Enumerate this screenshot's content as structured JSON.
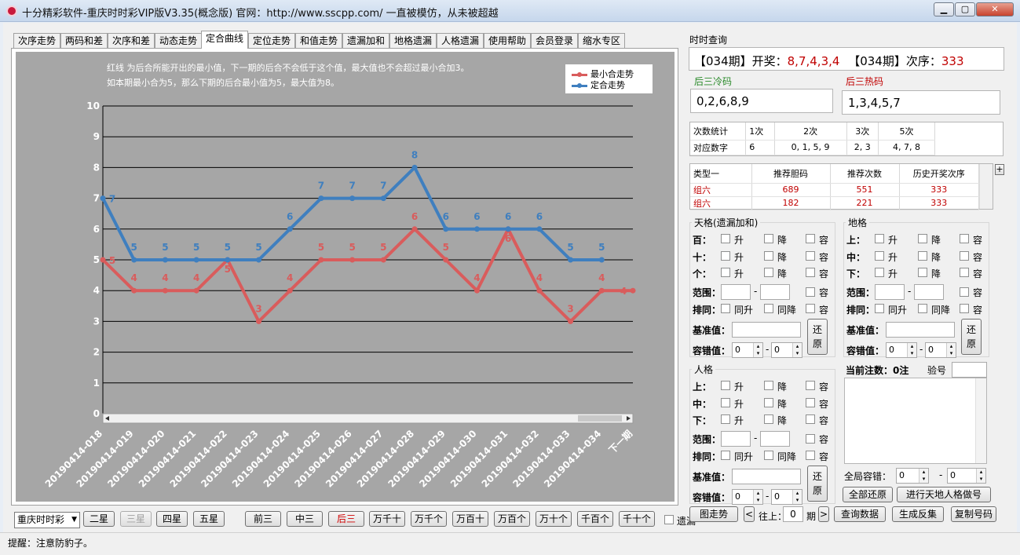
{
  "window": {
    "title": "十分精彩软件-重庆时时彩VIP版V3.35(概念版) 官网：http://www.sscpp.com/ 一直被模仿，从未被超越",
    "min": "▁",
    "max": "▢",
    "close": "✕"
  },
  "tabs": [
    "次序走势",
    "两码和差",
    "次序和差",
    "动态走势",
    "定合曲线",
    "定位走势",
    "和值走势",
    "遗漏加和",
    "地格遗漏",
    "人格遗漏",
    "使用帮助",
    "会员登录",
    "缩水专区"
  ],
  "active_tab": 4,
  "chart_note": [
    "红线 为后合所能开出的最小值，下一期的后合不会低于这个值，最大值也不会超过最小合加3。",
    "如本期最小合为5，那么下期的后合最小值为5，最大值为8。"
  ],
  "chart_data": {
    "type": "line",
    "categories": [
      "20190414-018",
      "20190414-019",
      "20190414-020",
      "20190414-021",
      "20190414-022",
      "20190414-023",
      "20190414-024",
      "20190414-025",
      "20190414-026",
      "20190414-027",
      "20190414-028",
      "20190414-029",
      "20190414-030",
      "20190414-031",
      "20190414-032",
      "20190414-033",
      "20190414-034",
      "下一期"
    ],
    "ylim": [
      0,
      10
    ],
    "yticks": [
      "0",
      "1",
      "2",
      "3",
      "4",
      "5",
      "6",
      "7",
      "8",
      "9",
      "10"
    ],
    "grid": true,
    "legend": "top-right",
    "series": [
      {
        "name": "最小合走势",
        "color": "#d95c5c",
        "values": [
          5,
          4,
          4,
          4,
          5,
          3,
          4,
          5,
          5,
          5,
          6,
          5,
          4,
          6,
          4,
          3,
          4,
          4
        ]
      },
      {
        "name": "定合走势",
        "color": "#3f7fbf",
        "values": [
          7,
          5,
          5,
          5,
          5,
          5,
          6,
          7,
          7,
          7,
          8,
          6,
          6,
          6,
          6,
          5,
          5
        ]
      }
    ]
  },
  "right": {
    "query_title": "时时查询",
    "draw_bracket_l": "【034期】开奖：",
    "draw_value": "8,7,4,3,4",
    "order_bracket": "【034期】次序：",
    "order_value": "333",
    "cold_title": "后三冷码",
    "cold_value": "0,2,6,8,9",
    "hot_title": "后三热码",
    "hot_value": "1,3,4,5,7",
    "count_head": [
      "次数统计",
      "1次",
      "2次",
      "3次",
      "5次"
    ],
    "count_row": [
      "对应数字",
      "6",
      "0, 1, 5, 9",
      "2, 3",
      "4, 7, 8"
    ],
    "rec_head": [
      "类型一",
      "推荐胆码",
      "推荐次数",
      "历史开奖次序"
    ],
    "rec_rows": [
      [
        "组六",
        "689",
        "551",
        "333"
      ],
      [
        "组六",
        "182",
        "221",
        "333"
      ]
    ],
    "plus": "+",
    "tiange": {
      "title": "天格(遗漏加和)",
      "rows": [
        "百：",
        "十：",
        "个："
      ]
    },
    "dige": {
      "title": "地格",
      "rows": [
        "上：",
        "中：",
        "下："
      ]
    },
    "renge": {
      "title": "人格",
      "rows": [
        "上：",
        "中：",
        "下："
      ]
    },
    "opt_up": "升",
    "opt_down": "降",
    "opt_tol": "容",
    "range_label": "范围：",
    "dash": "-",
    "same_label": "排同：",
    "same_up": "同升",
    "same_down": "同降",
    "base_label": "基准值：",
    "tol_label": "容错值：",
    "restore": "还原",
    "spin_zero": "0",
    "current_label": "当前注数：0注",
    "verify_label": "验号",
    "global_tol": "全局容错：",
    "reset_all": "全部还原",
    "do_number": "进行天地人格做号"
  },
  "bottom": {
    "select_value": "重庆时时彩",
    "buttons": [
      "二星",
      "三星",
      "四星",
      "五星",
      "前三",
      "中三",
      "后三",
      "万千十",
      "万千个",
      "万百十",
      "万百个",
      "万十个",
      "千百个",
      "千十个"
    ],
    "disabled": [
      1
    ],
    "highlight": [
      6
    ],
    "omit_label": "遗漏",
    "chart_btn": "图走势",
    "prev": "<",
    "next": ">",
    "back_label": "往上：",
    "back_value": "0",
    "period_label": "期",
    "query_btn": "查询数据",
    "invert_btn": "生成反集",
    "copy_btn": "复制号码"
  },
  "status": "提醒：注意防豹子。"
}
